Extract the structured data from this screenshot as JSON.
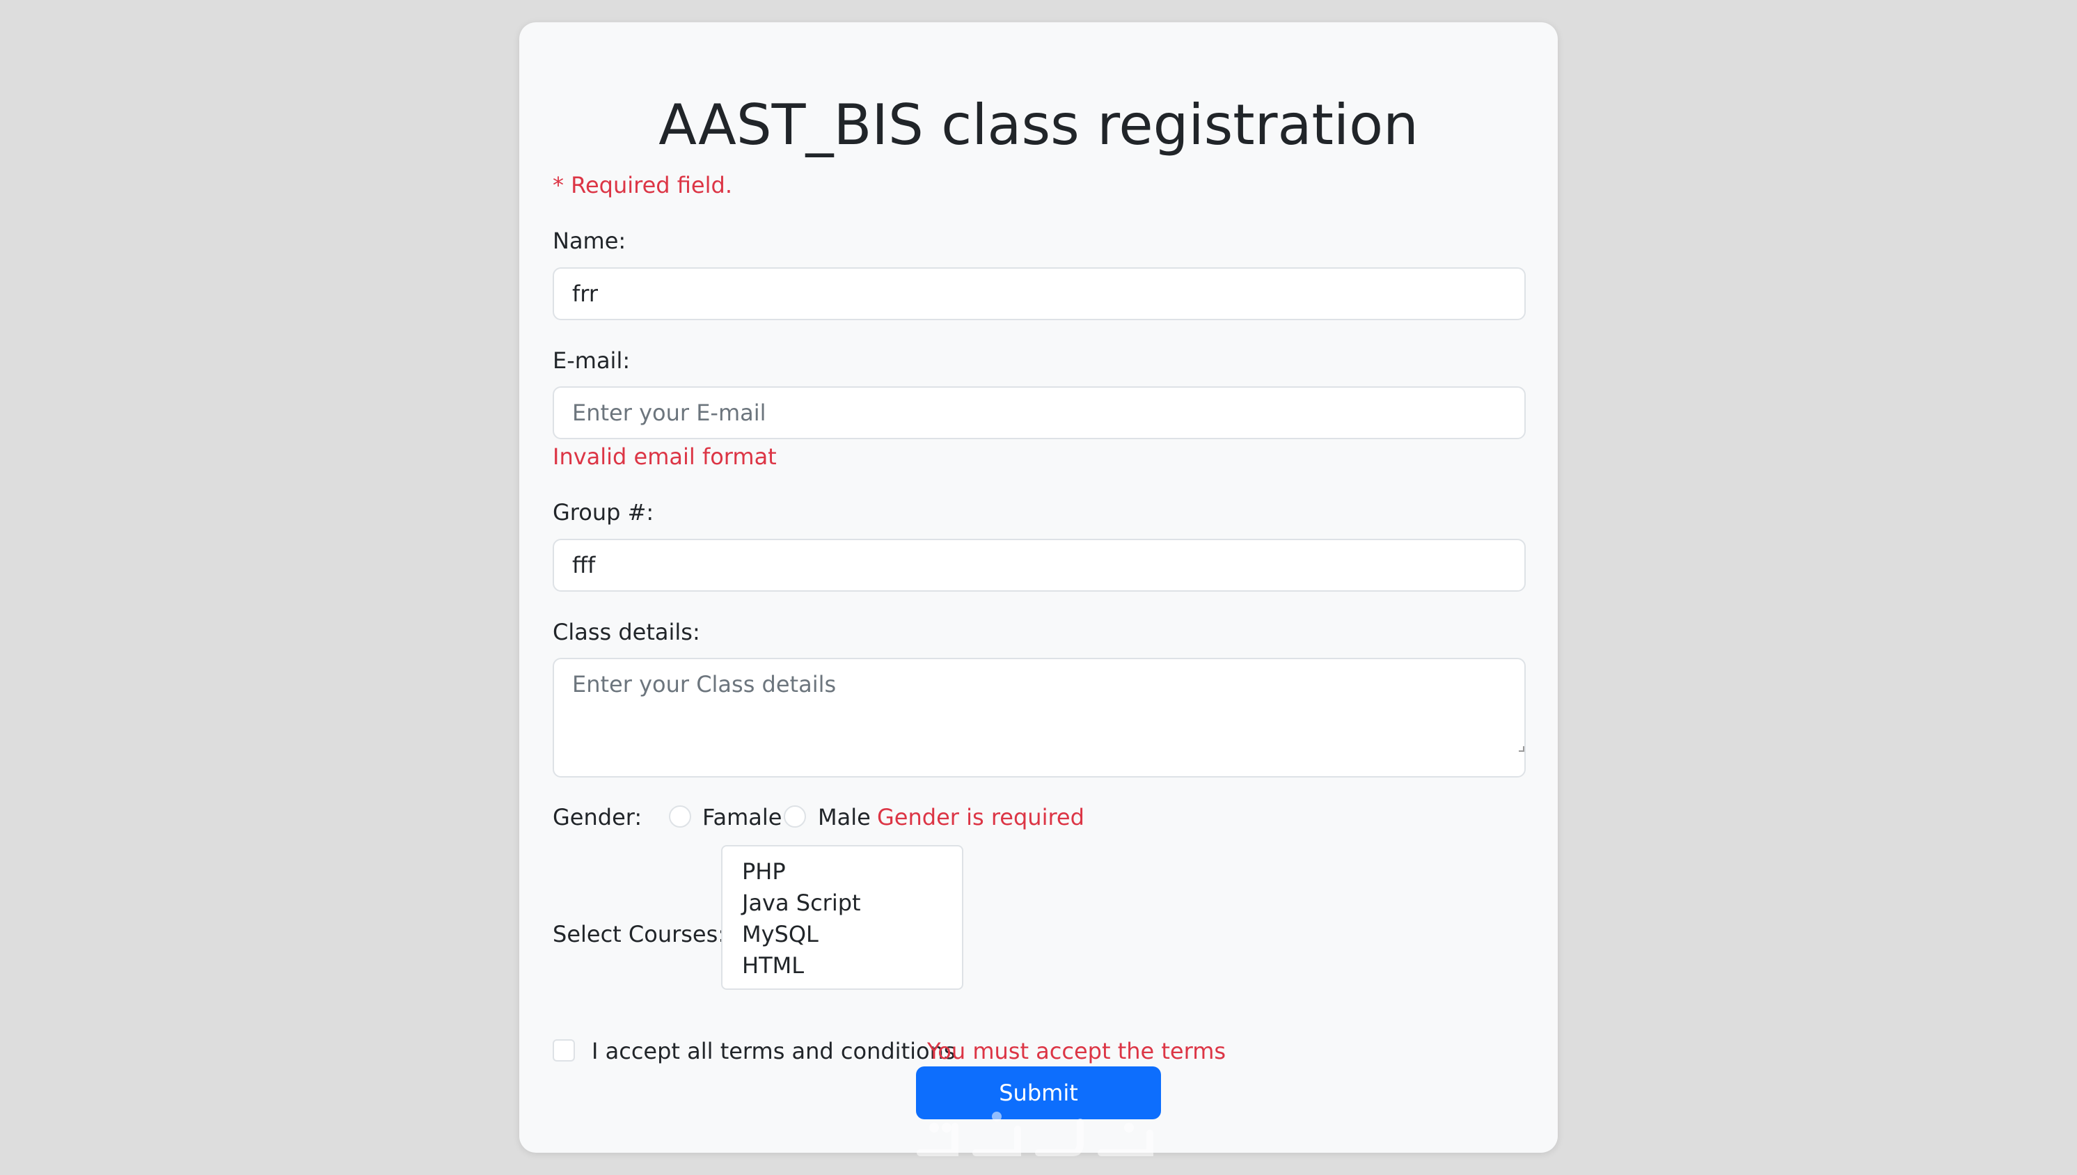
{
  "form": {
    "title": "AAST_BIS class registration",
    "required_note": "* Required field.",
    "name": {
      "label": "Name:",
      "value": "frr"
    },
    "email": {
      "label": "E-mail:",
      "value": "",
      "placeholder": "Enter your E-mail",
      "error": "Invalid email format"
    },
    "group": {
      "label": "Group #:",
      "value": "fff"
    },
    "class_details": {
      "label": "Class details:",
      "value": "",
      "placeholder": "Enter your Class details"
    },
    "gender": {
      "label": "Gender:",
      "options": [
        "Famale",
        "Male"
      ],
      "selected": null,
      "error": "Gender is required"
    },
    "courses": {
      "label": "Select Courses:",
      "options": [
        "PHP",
        "Java Script",
        "MySQL",
        "HTML"
      ]
    },
    "terms": {
      "label": "I accept all terms and conditions",
      "checked": false,
      "error": "You must accept the terms"
    },
    "submit_label": "Submit"
  },
  "colors": {
    "background": "#dddddd",
    "card": "#f8f9fa",
    "error": "#dc3545",
    "primary": "#0d6efd"
  }
}
